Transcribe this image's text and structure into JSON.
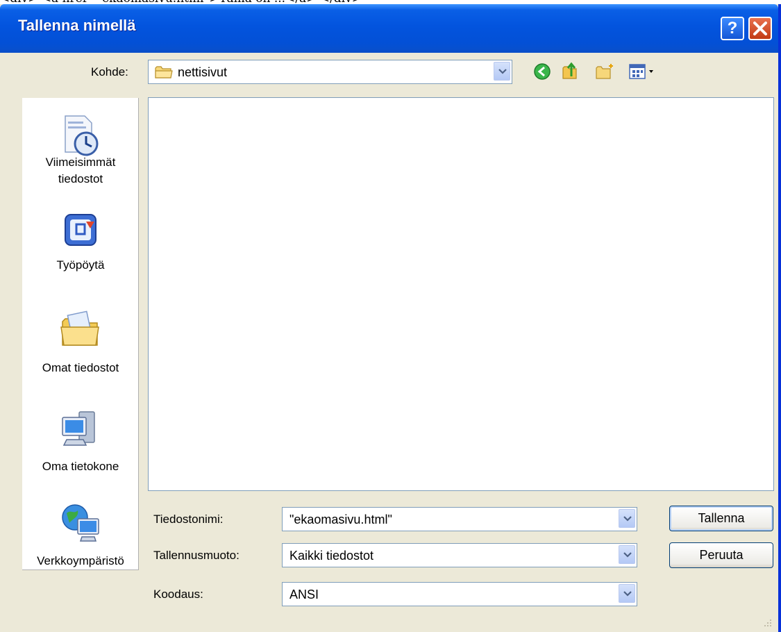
{
  "background_snippet": "<div> <a href=\"ekaomasivu.html\">Tämä on ...</a> </div>",
  "window": {
    "title": "Tallenna nimellä",
    "help_label": "?",
    "close_label": "✕"
  },
  "look_in": {
    "label": "Kohde:",
    "value": "nettisivut"
  },
  "toolbar": {
    "icons": [
      "back-icon",
      "up-folder-icon",
      "new-folder-icon",
      "views-menu-icon"
    ]
  },
  "places": [
    {
      "name": "recent",
      "label_line1": "Viimeisimmät",
      "label_line2": "tiedostot"
    },
    {
      "name": "desktop",
      "label_line1": "Työpöytä",
      "label_line2": ""
    },
    {
      "name": "my-documents",
      "label_line1": "Omat tiedostot",
      "label_line2": ""
    },
    {
      "name": "my-computer",
      "label_line1": "Oma tietokone",
      "label_line2": ""
    },
    {
      "name": "network",
      "label_line1": "Verkkoympäristö",
      "label_line2": ""
    }
  ],
  "form": {
    "filename_label": "Tiedostonimi:",
    "filename_value": "\"ekaomasivu.html\"",
    "type_label": "Tallennusmuoto:",
    "type_value": "Kaikki tiedostot",
    "encoding_label": "Koodaus:",
    "encoding_value": "ANSI"
  },
  "buttons": {
    "save": "Tallenna",
    "cancel": "Peruuta"
  },
  "colors": {
    "titlebar": "#0354de",
    "window_bg": "#ece9d8",
    "combo_border": "#7f9db9"
  }
}
